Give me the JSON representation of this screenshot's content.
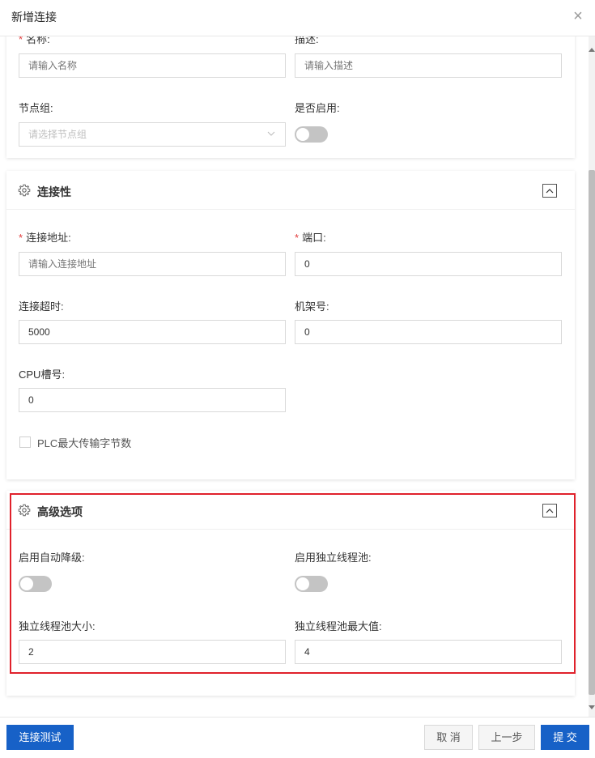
{
  "dialog": {
    "title": "新增连接",
    "close_glyph": "×"
  },
  "basic": {
    "name_label": "名称:",
    "name_placeholder": "请输入名称",
    "desc_label": "描述:",
    "desc_placeholder": "请输入描述",
    "node_group_label": "节点组:",
    "node_group_placeholder": "请选择节点组",
    "enabled_label": "是否启用:",
    "enabled_on": false
  },
  "connectivity": {
    "title": "连接性",
    "address_label": "连接地址:",
    "address_placeholder": "请输入连接地址",
    "port_label": "端口:",
    "port_value": "0",
    "timeout_label": "连接超时:",
    "timeout_value": "5000",
    "rack_label": "机架号:",
    "rack_value": "0",
    "cpu_slot_label": "CPU槽号:",
    "cpu_slot_value": "0",
    "plc_max_label": "PLC最大传输字节数",
    "plc_max_checked": false
  },
  "advanced": {
    "title": "高级选项",
    "auto_degrade_label": "启用自动降级:",
    "auto_degrade_on": false,
    "own_pool_label": "启用独立线程池:",
    "own_pool_on": false,
    "pool_size_label": "独立线程池大小:",
    "pool_size_value": "2",
    "pool_max_label": "独立线程池最大值:",
    "pool_max_value": "4"
  },
  "footer": {
    "test_label": "连接测试",
    "cancel_label": "取 消",
    "prev_label": "上一步",
    "submit_label": "提 交"
  },
  "colors": {
    "primary": "#1761c7",
    "required": "#e23c3c",
    "highlight": "#e0212b",
    "toggle_off": "#c4c4c4"
  },
  "icons": {
    "section": "gear-icon",
    "collapse": "chevron-up-icon",
    "close": "close-icon",
    "select": "chevron-down-icon"
  }
}
